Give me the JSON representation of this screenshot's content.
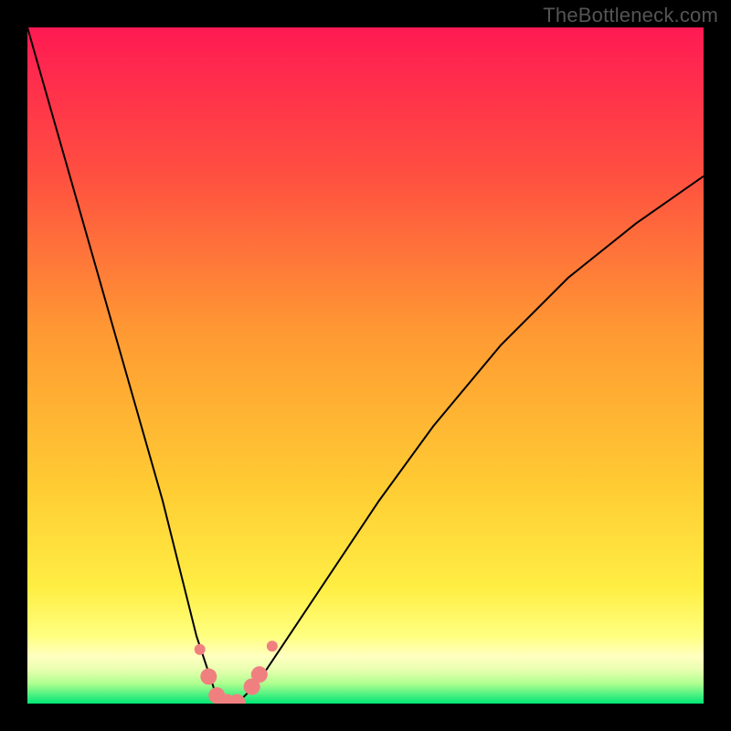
{
  "watermark": "TheBottleneck.com",
  "chart_data": {
    "type": "line",
    "title": "",
    "xlabel": "",
    "ylabel": "",
    "xlim": [
      0,
      100
    ],
    "ylim": [
      0,
      100
    ],
    "background_gradient": {
      "top_color": "#ff1a53",
      "mid_color": "#ffcc33",
      "bottom_colors": [
        "#ffff66",
        "#ffffb0",
        "#d0ff80",
        "#00e676"
      ]
    },
    "series": [
      {
        "name": "bottleneck-curve",
        "x": [
          0,
          4,
          8,
          12,
          16,
          20,
          23,
          25,
          27,
          28,
          29,
          30,
          32,
          34,
          38,
          44,
          52,
          60,
          70,
          80,
          90,
          100
        ],
        "y": [
          100,
          86,
          72,
          58,
          44,
          30,
          18,
          10,
          4,
          1,
          0,
          0,
          1,
          3,
          9,
          18,
          30,
          41,
          53,
          63,
          71,
          78
        ],
        "stroke": "#000000",
        "stroke_width": 2
      }
    ],
    "markers": {
      "name": "highlight-dots",
      "color": "#f08080",
      "radius_primary": 9,
      "radius_secondary": 6,
      "points": [
        {
          "x": 25.5,
          "y": 8
        },
        {
          "x": 26.8,
          "y": 4
        },
        {
          "x": 28.0,
          "y": 1.2
        },
        {
          "x": 29.5,
          "y": 0.2
        },
        {
          "x": 31.0,
          "y": 0.2
        },
        {
          "x": 33.2,
          "y": 2.5
        },
        {
          "x": 34.3,
          "y": 4.3
        },
        {
          "x": 36.2,
          "y": 8.5
        }
      ]
    }
  }
}
